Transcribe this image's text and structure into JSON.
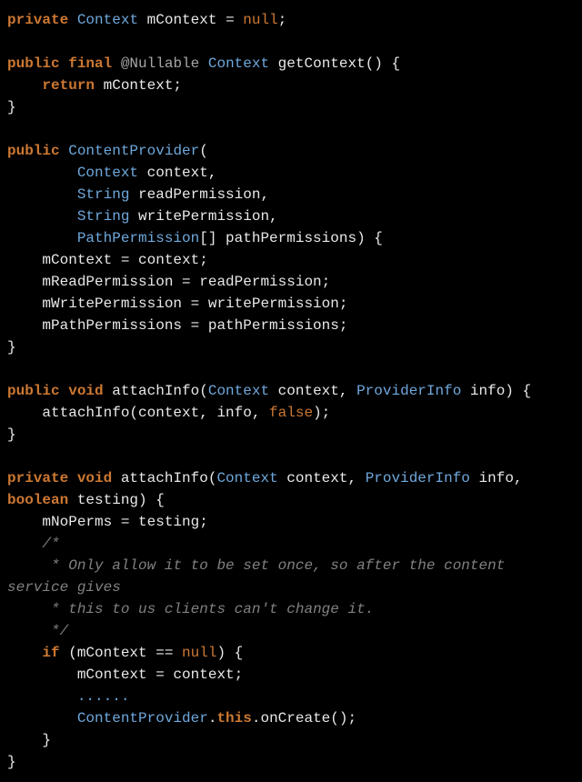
{
  "code": {
    "l1_kw1": "private",
    "l1_ty": "Context",
    "l1_rest": " mContext = ",
    "l1_lit": "null",
    "l1_semi": ";",
    "blank": "",
    "l2_kw1": "public",
    "l2_kw2": " final ",
    "l2_ann": "@Nullable",
    "l2_sp": " ",
    "l2_ty": "Context",
    "l2_name": " getContext() {",
    "l3": "    ",
    "l3_kw": "return",
    "l3_rest": " mContext;",
    "l4": "}",
    "l5_kw": "public",
    "l5_sp": " ",
    "l5_ty": "ContentProvider",
    "l5_op": "(",
    "l6_ind": "        ",
    "l6_ty": "Context",
    "l6_rest": " context,",
    "l7_ind": "        ",
    "l7_ty": "String",
    "l7_rest": " readPermission,",
    "l8_ind": "        ",
    "l8_ty": "String",
    "l8_rest": " writePermission,",
    "l9_ind": "        ",
    "l9_ty": "PathPermission",
    "l9_rest": "[] pathPermissions) {",
    "l10": "    mContext = context;",
    "l11": "    mReadPermission = readPermission;",
    "l12": "    mWritePermission = writePermission;",
    "l13": "    mPathPermissions = pathPermissions;",
    "l14": "}",
    "l15_kw1": "public",
    "l15_kw2": " void ",
    "l15_name": "attachInfo(",
    "l15_ty1": "Context",
    "l15_mid": " context, ",
    "l15_ty2": "ProviderInfo",
    "l15_rest": " info) {",
    "l16_ind": "    ",
    "l16_rest": "attachInfo(context, info, ",
    "l16_lit": "false",
    "l16_end": ");",
    "l17": "}",
    "l18_kw1": "private",
    "l18_kw2": " void ",
    "l18_name": "attachInfo(",
    "l18_ty1": "Context",
    "l18_mid": " context, ",
    "l18_ty2": "ProviderInfo",
    "l18_rest": " info, ",
    "l18_kw3": "boolean",
    "l18_end": " testing) {",
    "l19": "    mNoPerms = testing;",
    "l20": "    /*",
    "l21": "     * Only allow it to be set once, so after the content service gives",
    "l22": "     * this to us clients can't change it.",
    "l23": "     */",
    "l24_ind": "    ",
    "l24_kw": "if",
    "l24_rest": " (mContext == ",
    "l24_lit": "null",
    "l24_end": ") {",
    "l25": "        mContext = context;",
    "l26_ind": "        ",
    "l26_dots": "......",
    "l27_ind": "        ",
    "l27_ty": "ContentProvider",
    "l27_mid": ".",
    "l27_kw": "this",
    "l27_end": ".onCreate();",
    "l28": "    }",
    "l29": "}"
  }
}
